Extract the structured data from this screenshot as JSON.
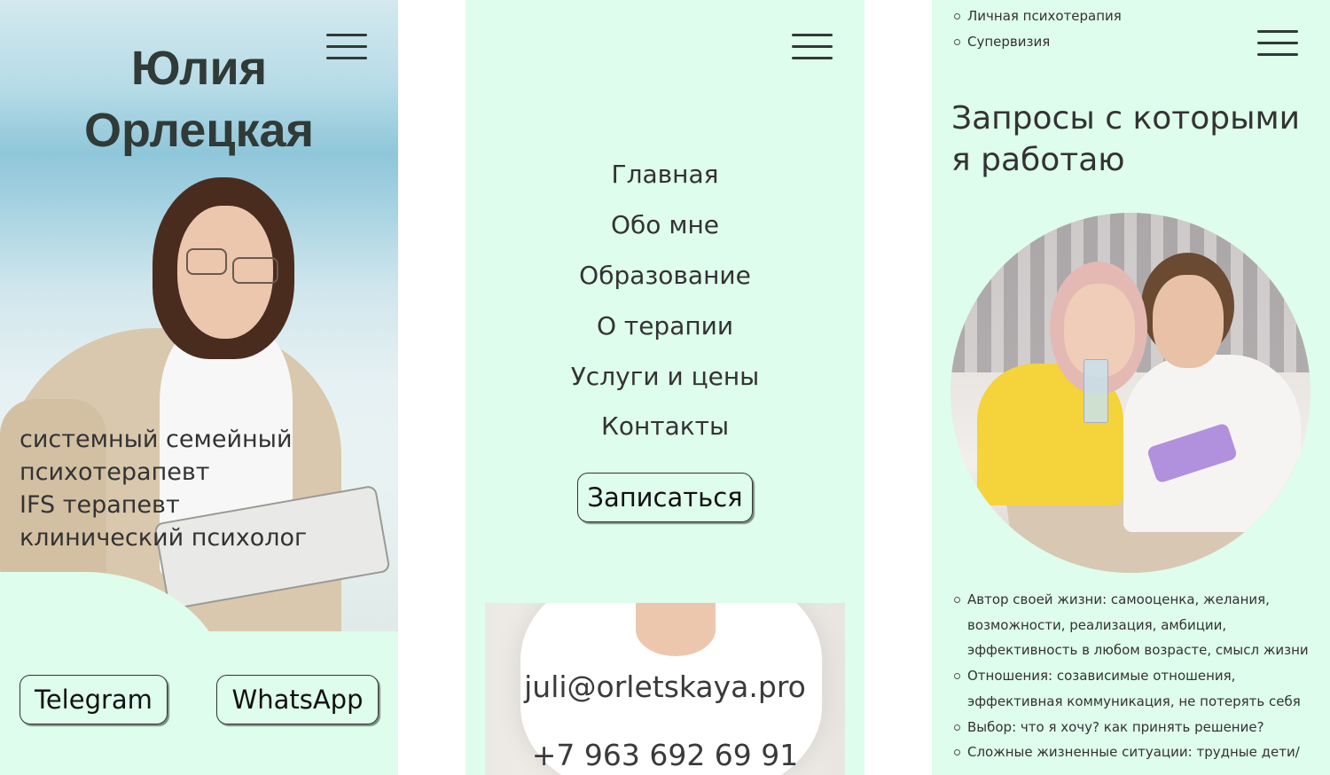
{
  "panel1": {
    "name_line1": "Юлия",
    "name_line2": "Орлецкая",
    "menu_icon": "hamburger-menu-icon",
    "roles": [
      "системный семейный",
      "психотерапевт",
      "IFS терапевт",
      "клинический психолог"
    ],
    "telegram_label": "Telegram",
    "whatsapp_label": "WhatsApp"
  },
  "panel2": {
    "menu_icon": "hamburger-menu-icon",
    "menu_items": [
      "Главная",
      "Обо мне",
      "Образование",
      "О терапии",
      "Услуги и цены",
      "Контакты"
    ],
    "signup_label": "Записаться",
    "email": "juli@orletskaya.pro",
    "phone": "+7 963 692 69 91"
  },
  "panel3": {
    "menu_icon": "hamburger-menu-icon",
    "top_items": [
      "Личная психотерапия",
      "Супервизия"
    ],
    "section_title_line1": "Запросы с которыми",
    "section_title_line2": "я работаю",
    "requests": [
      "Автор своей жизни: самооценка, желания, возможности, реализация, амбиции, эффективность в любом возрасте, смысл жизни",
      "Отношения: созависимые отношения, эффективная коммуникация, не потерять себя",
      "Выбор: что я хочу? как принять решение?",
      "Сложные жизненные ситуации: трудные дети/"
    ]
  },
  "colors": {
    "mint_background": "#defdec",
    "text_dark": "#333333"
  }
}
